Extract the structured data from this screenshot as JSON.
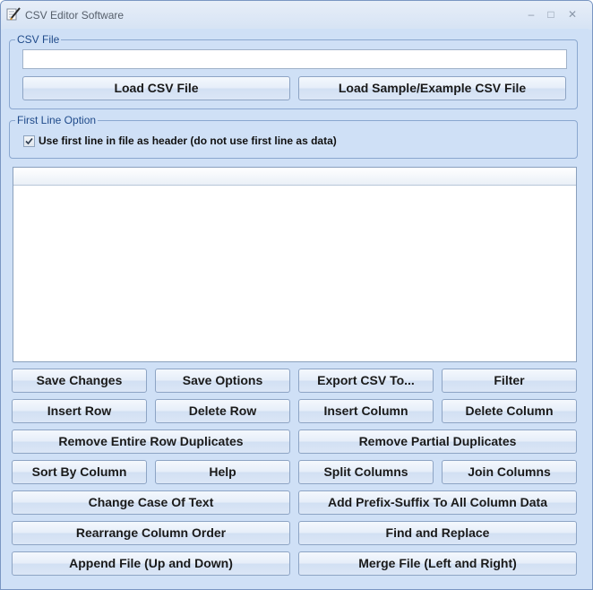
{
  "window": {
    "title": "CSV Editor Software",
    "minimize_label": "‒",
    "maximize_label": "□",
    "close_label": "✕"
  },
  "csv_file_group": {
    "legend": "CSV File",
    "file_path_value": "",
    "load_button": "Load CSV File",
    "load_sample_button": "Load Sample/Example CSV File"
  },
  "first_line_group": {
    "legend": "First Line Option",
    "checkbox_label": "Use first line in file as header (do not use first line as data)",
    "checked": true
  },
  "buttons": {
    "save_changes": "Save Changes",
    "save_options": "Save Options",
    "export_csv": "Export CSV To...",
    "filter": "Filter",
    "insert_row": "Insert Row",
    "delete_row": "Delete Row",
    "insert_column": "Insert Column",
    "delete_column": "Delete Column",
    "remove_row_duplicates": "Remove Entire Row Duplicates",
    "remove_partial_duplicates": "Remove Partial Duplicates",
    "sort_by_column": "Sort By Column",
    "help": "Help",
    "split_columns": "Split Columns",
    "join_columns": "Join Columns",
    "change_case": "Change Case Of Text",
    "add_prefix_suffix": "Add Prefix-Suffix To All Column Data",
    "rearrange_columns": "Rearrange Column Order",
    "find_replace": "Find and Replace",
    "append_file": "Append File (Up and Down)",
    "merge_file": "Merge File (Left and Right)"
  },
  "colors": {
    "client_background": "#cfe0f6",
    "group_border": "#8aa7cf",
    "legend_text": "#1f4a8a"
  },
  "icons": {
    "app_icon": "pencil-edit-icon",
    "checkbox_mark": "checkmark-icon"
  }
}
